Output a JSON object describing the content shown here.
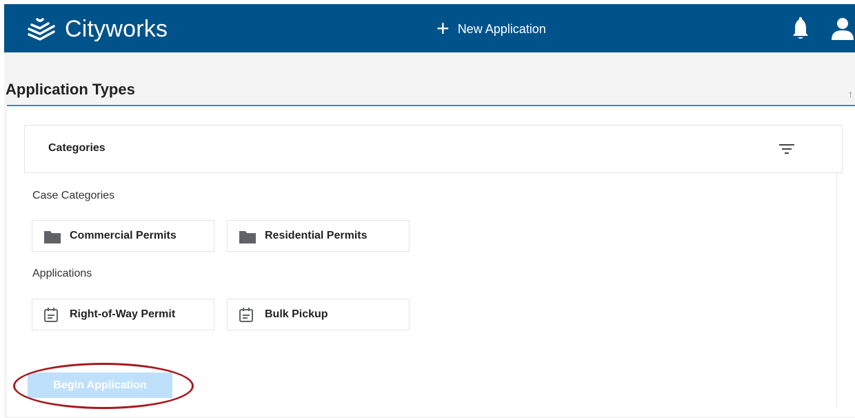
{
  "header": {
    "app_name": "Cityworks",
    "new_application_label": "New Application",
    "brand_color": "#00538a",
    "icons": [
      "cityworks-logo-icon",
      "plus-icon",
      "bell-icon",
      "user-icon"
    ]
  },
  "main": {
    "section_title": "Application Types",
    "categories_label": "Categories",
    "filter_icon": "filter-icon",
    "case_categories": {
      "label": "Case Categories",
      "items": [
        {
          "label": "Commercial Permits",
          "icon": "folder-icon"
        },
        {
          "label": "Residential Permits",
          "icon": "folder-icon"
        }
      ]
    },
    "applications": {
      "label": "Applications",
      "items": [
        {
          "label": "Right-of-Way Permit",
          "icon": "form-icon"
        },
        {
          "label": "Bulk Pickup",
          "icon": "form-icon"
        }
      ]
    },
    "begin_button_label": "Begin Application",
    "accent_color": "#2b8ad8",
    "annotation_color": "#a61a1f"
  }
}
